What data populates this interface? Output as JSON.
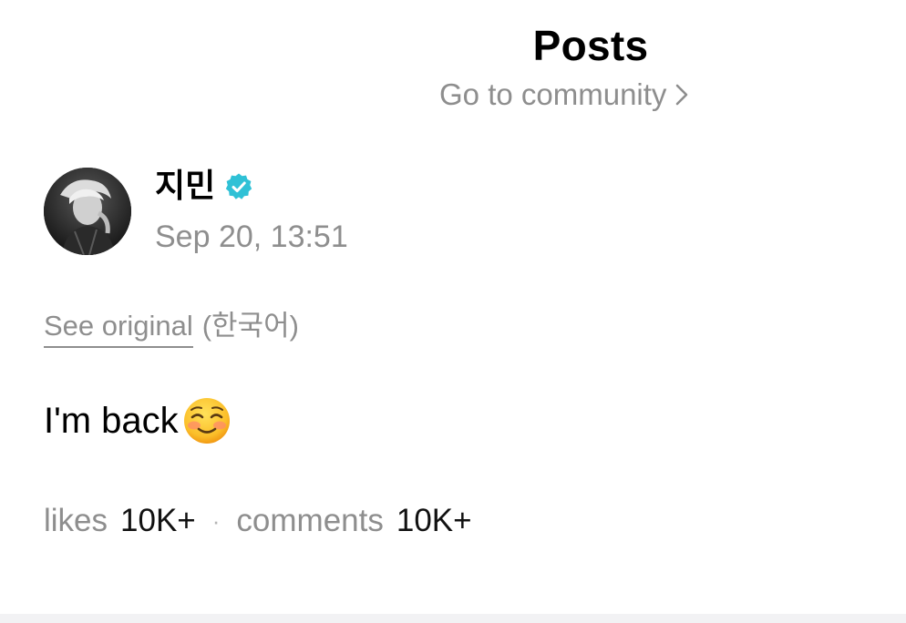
{
  "header": {
    "title": "Posts",
    "community_link": "Go to community",
    "chevron_icon": "chevron-right-icon"
  },
  "post": {
    "author": {
      "name": "지민",
      "verified_icon": "verified-badge-icon",
      "verified_color": "#2fc1d6",
      "avatar_icon": "avatar-photo"
    },
    "timestamp": "Sep 20, 13:51",
    "translation": {
      "see_original": "See original",
      "language": "(한국어)"
    },
    "body": {
      "text": "I'm back",
      "emoji_icon": "smiling-face-icon"
    },
    "stats": {
      "likes_label": "likes",
      "likes_value": "10K+",
      "separator": "·",
      "comments_label": "comments",
      "comments_value": "10K+"
    }
  }
}
